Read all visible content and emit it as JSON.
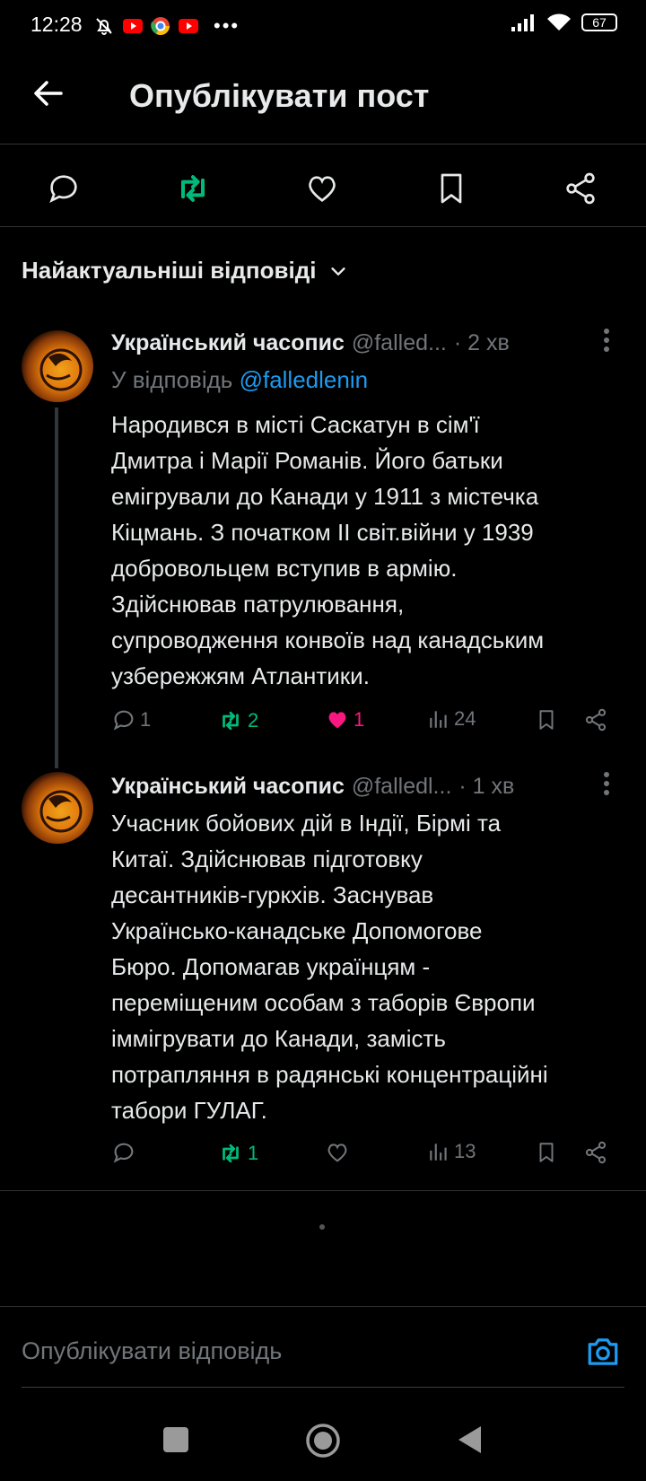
{
  "status_bar": {
    "time": "12:28",
    "battery": "67"
  },
  "header": {
    "title": "Опублікувати пост"
  },
  "sort": {
    "label": "Найактуальніші відповіді"
  },
  "tweets": [
    {
      "name": "Український часопис",
      "handle": "@falled...",
      "time": "· 2 хв",
      "reply_prefix": "У відповідь ",
      "reply_handle": "@falledlenin",
      "lines": [
        "Народився в місті Саскатун в сім'ї",
        "Дмитра і Марії Романів. Його батьки",
        "емігрували до Канади у 1911 з містечка",
        "Кіцмань. З початком ІІ світ.війни у 1939",
        "добровольцем вступив в армію.",
        "Здійснював патрулювання,",
        "супроводження конвоїв над канадським",
        "узбережжям Атлантики."
      ],
      "stats": {
        "replies": "1",
        "reposts": "2",
        "likes": "1",
        "views": "24"
      }
    },
    {
      "name": "Український часопис",
      "handle": "@falledl...",
      "time": "· 1 хв",
      "lines": [
        "Учасник бойових дій в Індії, Бірмі та",
        "Китаї. Здійснював підготовку",
        "десантників-гуркхів. Заснував",
        "Українсько-канадське Допомогове",
        "Бюро. Допомагав українцям -",
        "переміщеним особам з таборів Європи",
        "іммігрувати до Канади, замість",
        "потрапляння в радянські концентраційні",
        "табори ГУЛАГ."
      ],
      "stats": {
        "replies": "",
        "reposts": "1",
        "likes": "",
        "views": "13"
      }
    }
  ],
  "composer": {
    "placeholder": "Опублікувати відповідь"
  },
  "colors": {
    "accent": "#1d9bf0",
    "repost": "#00ba7c",
    "like": "#f91880",
    "muted": "#71767b"
  }
}
